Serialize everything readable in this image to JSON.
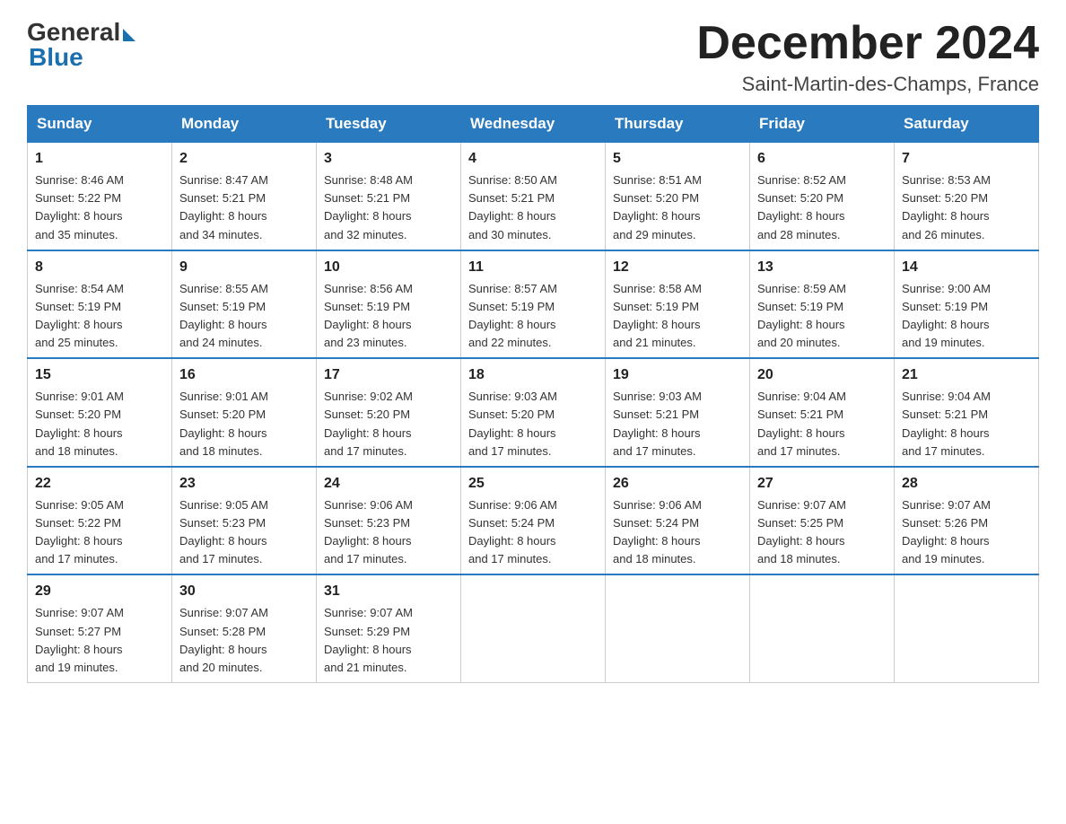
{
  "logo": {
    "general": "General",
    "blue": "Blue"
  },
  "title": "December 2024",
  "location": "Saint-Martin-des-Champs, France",
  "weekdays": [
    "Sunday",
    "Monday",
    "Tuesday",
    "Wednesday",
    "Thursday",
    "Friday",
    "Saturday"
  ],
  "weeks": [
    [
      {
        "day": "1",
        "sunrise": "8:46 AM",
        "sunset": "5:22 PM",
        "daylight": "8 hours and 35 minutes."
      },
      {
        "day": "2",
        "sunrise": "8:47 AM",
        "sunset": "5:21 PM",
        "daylight": "8 hours and 34 minutes."
      },
      {
        "day": "3",
        "sunrise": "8:48 AM",
        "sunset": "5:21 PM",
        "daylight": "8 hours and 32 minutes."
      },
      {
        "day": "4",
        "sunrise": "8:50 AM",
        "sunset": "5:21 PM",
        "daylight": "8 hours and 30 minutes."
      },
      {
        "day": "5",
        "sunrise": "8:51 AM",
        "sunset": "5:20 PM",
        "daylight": "8 hours and 29 minutes."
      },
      {
        "day": "6",
        "sunrise": "8:52 AM",
        "sunset": "5:20 PM",
        "daylight": "8 hours and 28 minutes."
      },
      {
        "day": "7",
        "sunrise": "8:53 AM",
        "sunset": "5:20 PM",
        "daylight": "8 hours and 26 minutes."
      }
    ],
    [
      {
        "day": "8",
        "sunrise": "8:54 AM",
        "sunset": "5:19 PM",
        "daylight": "8 hours and 25 minutes."
      },
      {
        "day": "9",
        "sunrise": "8:55 AM",
        "sunset": "5:19 PM",
        "daylight": "8 hours and 24 minutes."
      },
      {
        "day": "10",
        "sunrise": "8:56 AM",
        "sunset": "5:19 PM",
        "daylight": "8 hours and 23 minutes."
      },
      {
        "day": "11",
        "sunrise": "8:57 AM",
        "sunset": "5:19 PM",
        "daylight": "8 hours and 22 minutes."
      },
      {
        "day": "12",
        "sunrise": "8:58 AM",
        "sunset": "5:19 PM",
        "daylight": "8 hours and 21 minutes."
      },
      {
        "day": "13",
        "sunrise": "8:59 AM",
        "sunset": "5:19 PM",
        "daylight": "8 hours and 20 minutes."
      },
      {
        "day": "14",
        "sunrise": "9:00 AM",
        "sunset": "5:19 PM",
        "daylight": "8 hours and 19 minutes."
      }
    ],
    [
      {
        "day": "15",
        "sunrise": "9:01 AM",
        "sunset": "5:20 PM",
        "daylight": "8 hours and 18 minutes."
      },
      {
        "day": "16",
        "sunrise": "9:01 AM",
        "sunset": "5:20 PM",
        "daylight": "8 hours and 18 minutes."
      },
      {
        "day": "17",
        "sunrise": "9:02 AM",
        "sunset": "5:20 PM",
        "daylight": "8 hours and 17 minutes."
      },
      {
        "day": "18",
        "sunrise": "9:03 AM",
        "sunset": "5:20 PM",
        "daylight": "8 hours and 17 minutes."
      },
      {
        "day": "19",
        "sunrise": "9:03 AM",
        "sunset": "5:21 PM",
        "daylight": "8 hours and 17 minutes."
      },
      {
        "day": "20",
        "sunrise": "9:04 AM",
        "sunset": "5:21 PM",
        "daylight": "8 hours and 17 minutes."
      },
      {
        "day": "21",
        "sunrise": "9:04 AM",
        "sunset": "5:21 PM",
        "daylight": "8 hours and 17 minutes."
      }
    ],
    [
      {
        "day": "22",
        "sunrise": "9:05 AM",
        "sunset": "5:22 PM",
        "daylight": "8 hours and 17 minutes."
      },
      {
        "day": "23",
        "sunrise": "9:05 AM",
        "sunset": "5:23 PM",
        "daylight": "8 hours and 17 minutes."
      },
      {
        "day": "24",
        "sunrise": "9:06 AM",
        "sunset": "5:23 PM",
        "daylight": "8 hours and 17 minutes."
      },
      {
        "day": "25",
        "sunrise": "9:06 AM",
        "sunset": "5:24 PM",
        "daylight": "8 hours and 17 minutes."
      },
      {
        "day": "26",
        "sunrise": "9:06 AM",
        "sunset": "5:24 PM",
        "daylight": "8 hours and 18 minutes."
      },
      {
        "day": "27",
        "sunrise": "9:07 AM",
        "sunset": "5:25 PM",
        "daylight": "8 hours and 18 minutes."
      },
      {
        "day": "28",
        "sunrise": "9:07 AM",
        "sunset": "5:26 PM",
        "daylight": "8 hours and 19 minutes."
      }
    ],
    [
      {
        "day": "29",
        "sunrise": "9:07 AM",
        "sunset": "5:27 PM",
        "daylight": "8 hours and 19 minutes."
      },
      {
        "day": "30",
        "sunrise": "9:07 AM",
        "sunset": "5:28 PM",
        "daylight": "8 hours and 20 minutes."
      },
      {
        "day": "31",
        "sunrise": "9:07 AM",
        "sunset": "5:29 PM",
        "daylight": "8 hours and 21 minutes."
      },
      null,
      null,
      null,
      null
    ]
  ],
  "labels": {
    "sunrise": "Sunrise:",
    "sunset": "Sunset:",
    "daylight": "Daylight:"
  }
}
